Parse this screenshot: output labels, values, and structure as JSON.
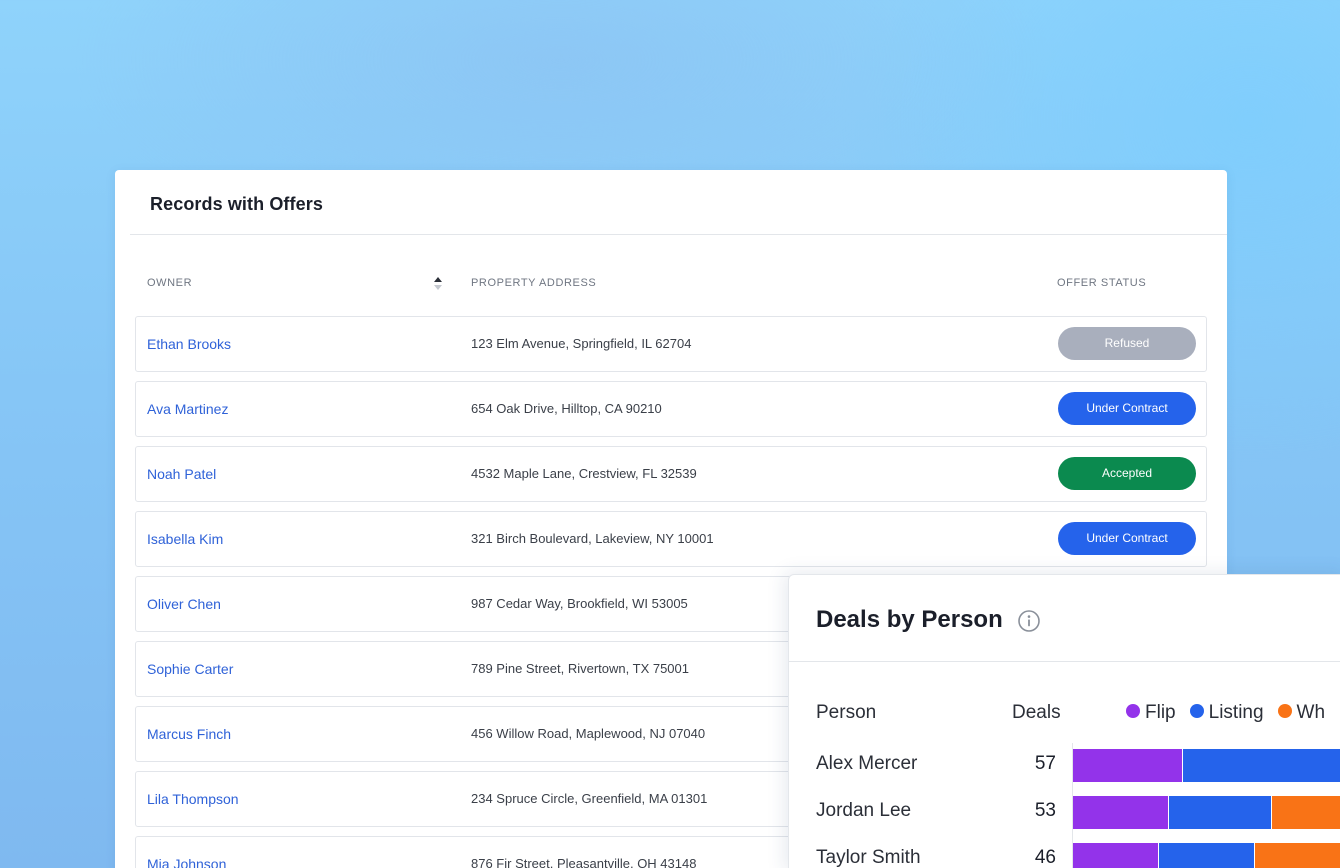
{
  "records": {
    "title": "Records with Offers",
    "columns": {
      "owner": "OWNER",
      "address": "PROPERTY ADDRESS",
      "status": "OFFER STATUS"
    },
    "rows": [
      {
        "owner": "Ethan Brooks",
        "address": "123 Elm Avenue, Springfield, IL 62704",
        "status": "Refused"
      },
      {
        "owner": "Ava Martinez",
        "address": "654 Oak Drive, Hilltop, CA 90210",
        "status": "Under Contract"
      },
      {
        "owner": "Noah Patel",
        "address": "4532 Maple Lane, Crestview, FL 32539",
        "status": "Accepted"
      },
      {
        "owner": "Isabella Kim",
        "address": "321 Birch Boulevard, Lakeview, NY 10001",
        "status": "Under Contract"
      },
      {
        "owner": "Oliver Chen",
        "address": "987 Cedar Way, Brookfield, WI 53005"
      },
      {
        "owner": "Sophie Carter",
        "address": "789 Pine Street, Rivertown, TX 75001"
      },
      {
        "owner": "Marcus Finch",
        "address": "456 Willow Road, Maplewood, NJ 07040"
      },
      {
        "owner": "Lila Thompson",
        "address": "234 Spruce Circle, Greenfield, MA 01301"
      },
      {
        "owner": "Mia Johnson",
        "address": "876 Fir Street, Pleasantville, OH 43148"
      }
    ],
    "status_colors": {
      "Refused": "#a9afbd",
      "Under Contract": "#2563eb",
      "Accepted": "#0b8a4f"
    }
  },
  "deals": {
    "title": "Deals by Person",
    "headers": {
      "person": "Person",
      "deals": "Deals"
    },
    "legend": [
      {
        "name": "Flip",
        "color": "#9333ea"
      },
      {
        "name": "Listing",
        "color": "#2563eb"
      },
      {
        "name": "Wh",
        "color": "#f97316"
      }
    ],
    "people": [
      {
        "name": "Alex Mercer",
        "deals": "57",
        "flip": 0.23,
        "listing": 0.77,
        "other": 0
      },
      {
        "name": "Jordan Lee",
        "deals": "53",
        "flip": 0.2,
        "listing": 0.215,
        "other": 0.585
      },
      {
        "name": "Taylor Smith",
        "deals": "46",
        "flip": 0.18,
        "listing": 0.2,
        "other": 0.62
      }
    ]
  },
  "icons": {
    "sort": "sort-icon",
    "info": "info-icon"
  }
}
